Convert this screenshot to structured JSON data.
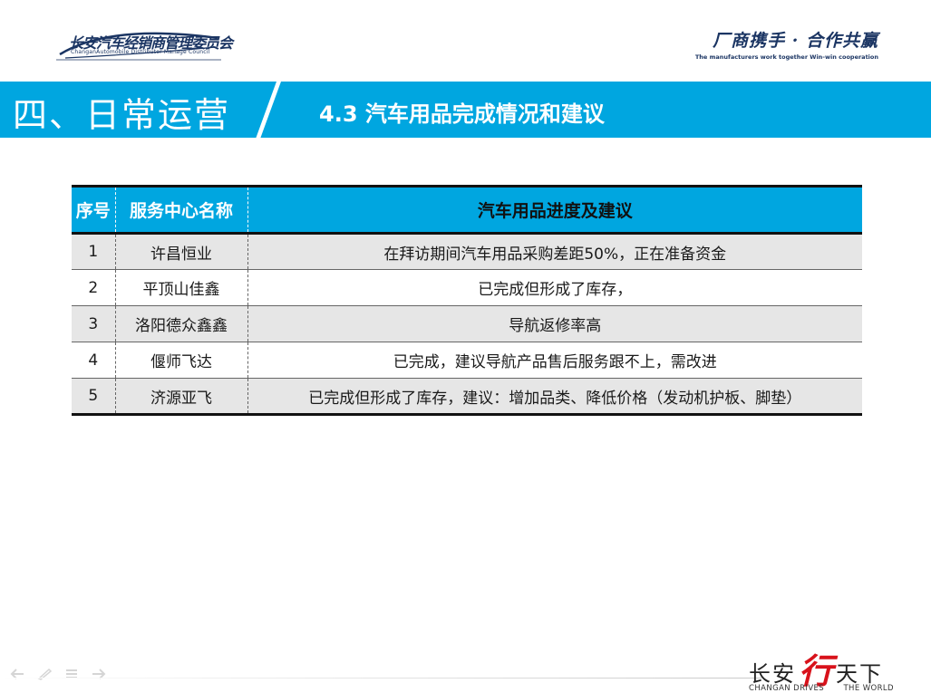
{
  "header": {
    "logo_cn": "长安汽车经销商管理委员会",
    "logo_en": "ChanganAutomobile Distributor Manage Council",
    "slogan_cn": "厂商携手 · 合作共赢",
    "slogan_en": "The manufacturers work together Win-win cooperation"
  },
  "band": {
    "section_title": "四、日常运营",
    "sub_title": "4.3 汽车用品完成情况和建议"
  },
  "table": {
    "headers": {
      "index": "序号",
      "center": "服务中心名称",
      "progress": "汽车用品进度及建议"
    },
    "rows": [
      {
        "index": "1",
        "center": "许昌恒业",
        "progress": "在拜访期间汽车用品采购差距50%，正在准备资金"
      },
      {
        "index": "2",
        "center": "平顶山佳鑫",
        "progress": "已完成但形成了库存，"
      },
      {
        "index": "3",
        "center": "洛阳德众鑫鑫",
        "progress": "导航返修率高"
      },
      {
        "index": "4",
        "center": "偃师飞达",
        "progress": "已完成，建议导航产品售后服务跟不上，需改进"
      },
      {
        "index": "5",
        "center": "济源亚飞",
        "progress": "已完成但形成了库存，建议：增加品类、降低价格（发动机护板、脚垫）"
      }
    ]
  },
  "brand": {
    "cn_left": "长安",
    "cn_mark": "行",
    "cn_right": "天下",
    "en_left": "CHANGAN DRIVES",
    "en_right": "THE WORLD"
  },
  "colors": {
    "accent": "#00a6e0",
    "navy": "#1b3563",
    "brand_red": "#d8121b",
    "row_gray": "#e6e6e6"
  },
  "icons": [
    "back-arrow-icon",
    "pen-icon",
    "menu-icon",
    "forward-arrow-icon"
  ]
}
